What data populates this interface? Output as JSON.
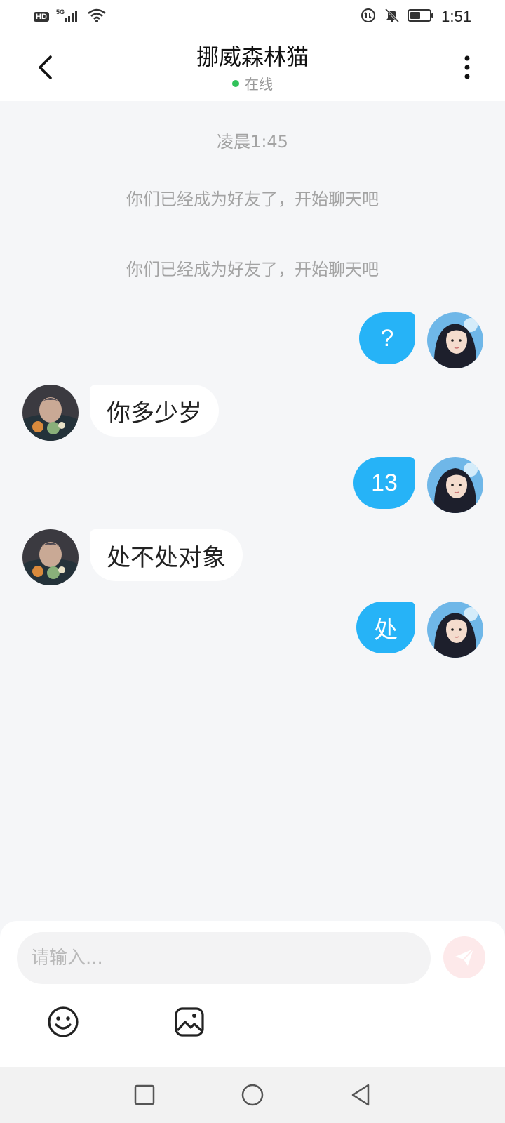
{
  "status_bar": {
    "left_badges": [
      "HD",
      "5G"
    ],
    "time": "1:51"
  },
  "header": {
    "title": "挪威森林猫",
    "status": "在线",
    "status_color": "#31c25a"
  },
  "chat": {
    "timestamp": "凌晨1:45",
    "system_messages": [
      "你们已经成为好友了，开始聊天吧",
      "你们已经成为好友了，开始聊天吧"
    ],
    "messages": [
      {
        "side": "right",
        "text": "?"
      },
      {
        "side": "left",
        "text": "你多少岁"
      },
      {
        "side": "right",
        "text": "13"
      },
      {
        "side": "left",
        "text": "处不处对象"
      },
      {
        "side": "right",
        "text": "处"
      }
    ],
    "bubble_color_self": "#26b3f7"
  },
  "input": {
    "placeholder": "请输入..."
  },
  "icons": {
    "back": "chevron-left-icon",
    "more": "more-vertical-icon",
    "send": "send-icon",
    "emoji": "emoji-icon",
    "image": "image-icon"
  }
}
